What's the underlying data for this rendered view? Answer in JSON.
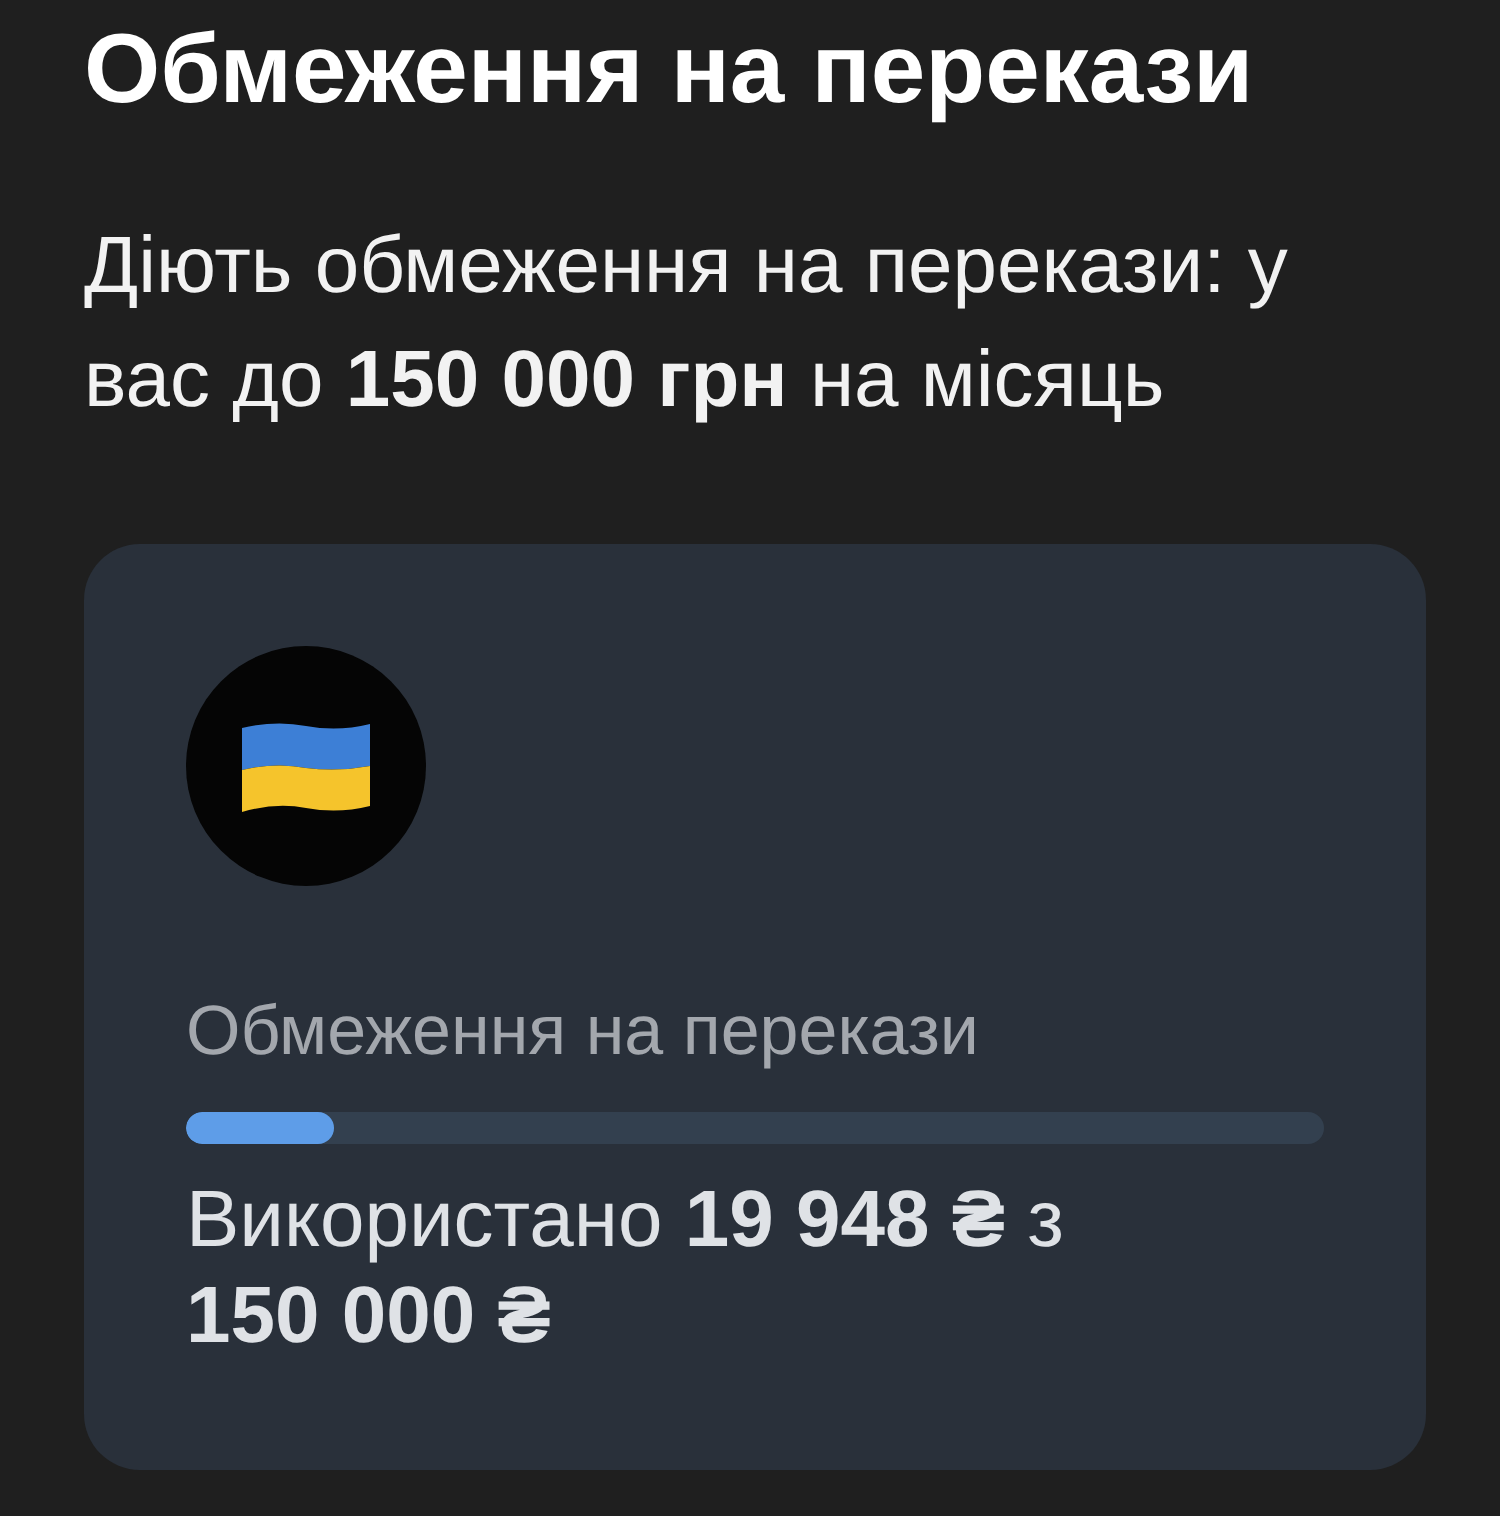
{
  "title": "Обмеження на перекази",
  "description": "Діють обмеження на перекази: у вас до **150 000 грн** на місяць",
  "card": {
    "label": "Обмеження на перекази",
    "progress": {
      "level": 0.13
    },
    "usage": "Використано **19 948 ₴** з **150 000 ₴**"
  }
}
